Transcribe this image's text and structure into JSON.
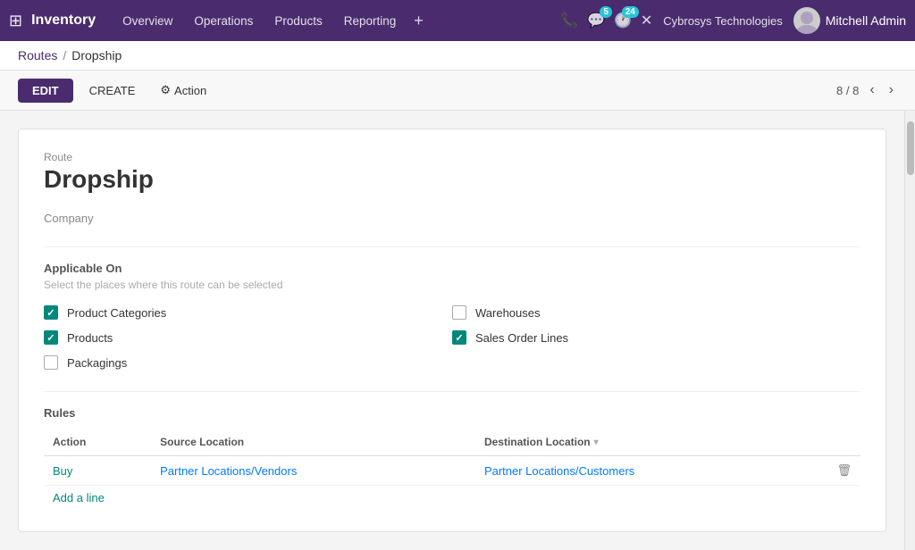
{
  "topnav": {
    "brand": "Inventory",
    "links": [
      {
        "label": "Overview",
        "key": "overview"
      },
      {
        "label": "Operations",
        "key": "operations"
      },
      {
        "label": "Products",
        "key": "products"
      },
      {
        "label": "Reporting",
        "key": "reporting"
      }
    ],
    "plus_label": "+",
    "company": "Cybrosys Technologies",
    "user": "Mitchell Admin",
    "icons": {
      "phone": "📞",
      "chat": "💬",
      "chat_badge": "5",
      "clock": "🕐",
      "clock_badge": "24",
      "close": "✕"
    }
  },
  "breadcrumb": {
    "parent": "Routes",
    "separator": "/",
    "current": "Dropship"
  },
  "toolbar": {
    "edit_label": "EDIT",
    "create_label": "CREATE",
    "action_icon": "⚙",
    "action_label": "Action",
    "pager": "8 / 8"
  },
  "record": {
    "label": "Route",
    "title": "Dropship",
    "company_label": "Company",
    "company_value": ""
  },
  "applicable_on": {
    "header": "Applicable On",
    "hint": "Select the places where this route can be selected",
    "items": [
      {
        "label": "Product Categories",
        "checked": true,
        "col": "left"
      },
      {
        "label": "Warehouses",
        "checked": false,
        "col": "right"
      },
      {
        "label": "Products",
        "checked": true,
        "col": "left"
      },
      {
        "label": "Sales Order Lines",
        "checked": true,
        "col": "right"
      },
      {
        "label": "Packagings",
        "checked": false,
        "col": "left"
      }
    ]
  },
  "rules": {
    "header": "Rules",
    "columns": [
      {
        "label": "Action",
        "key": "action"
      },
      {
        "label": "Source Location",
        "key": "source"
      },
      {
        "label": "Destination Location",
        "key": "dest",
        "sortable": true
      }
    ],
    "rows": [
      {
        "action": "Buy",
        "source": "Partner Locations/Vendors",
        "dest": "Partner Locations/Customers"
      }
    ],
    "add_line_label": "Add a line"
  }
}
